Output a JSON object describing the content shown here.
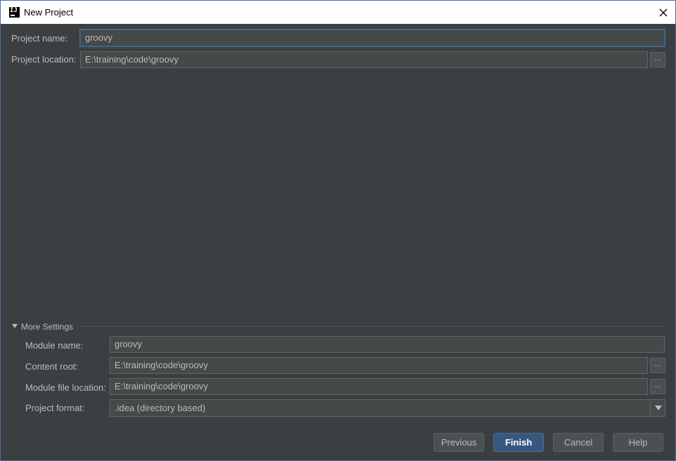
{
  "window": {
    "title": "New Project"
  },
  "project": {
    "name_label": "Project name:",
    "name_value": "groovy",
    "location_label": "Project location:",
    "location_value": "E:\\training\\code\\groovy",
    "browse_label": "..."
  },
  "more_settings": {
    "header": "More Settings",
    "module_name_label": "Module name:",
    "module_name_value": "groovy",
    "content_root_label": "Content root:",
    "content_root_value": "E:\\training\\code\\groovy",
    "module_file_label": "Module file location:",
    "module_file_value": "E:\\training\\code\\groovy",
    "project_format_label": "Project format:",
    "project_format_value": ".idea (directory based)"
  },
  "buttons": {
    "previous": "Previous",
    "finish": "Finish",
    "cancel": "Cancel",
    "help": "Help"
  },
  "colors": {
    "background": "#3c3f41",
    "field_background": "#45494a",
    "primary_button": "#365880",
    "focus_border": "#3d6185"
  }
}
